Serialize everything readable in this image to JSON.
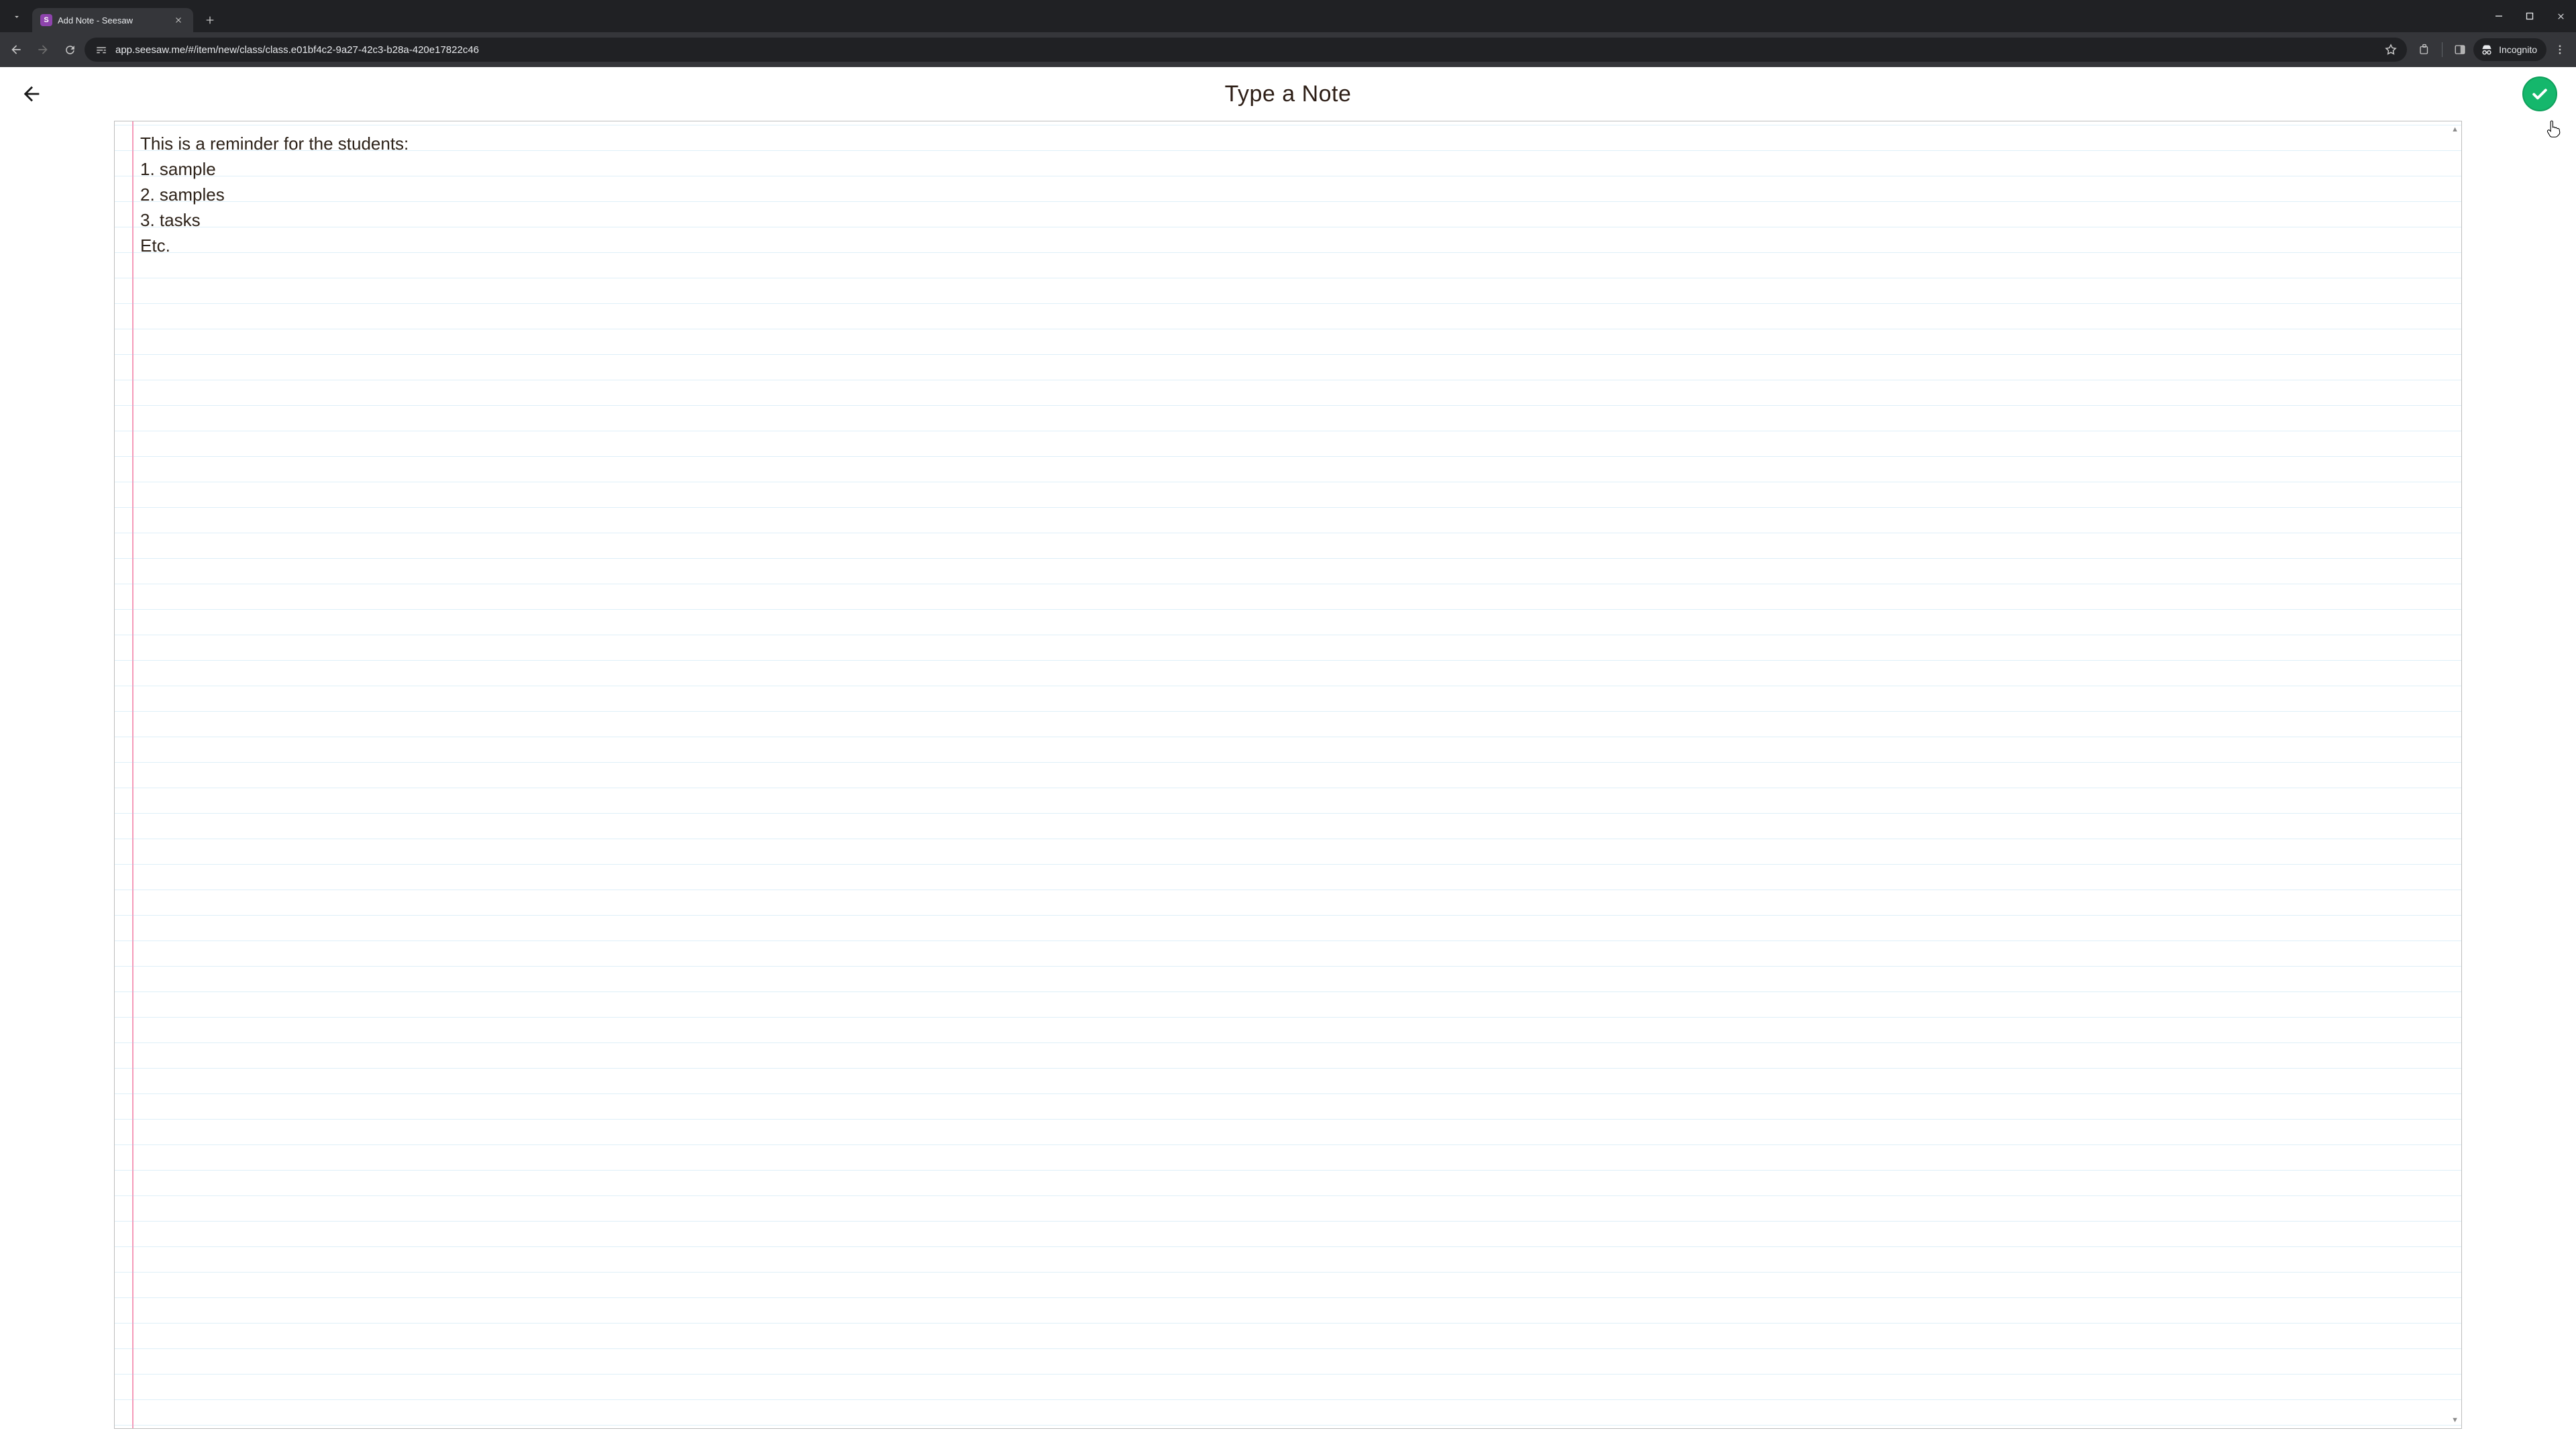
{
  "browser": {
    "tab_title": "Add Note - Seesaw",
    "favicon_letter": "S",
    "url": "app.seesaw.me/#/item/new/class/class.e01bf4c2-9a27-42c3-b28a-420e17822c46",
    "incognito_label": "Incognito"
  },
  "page": {
    "title": "Type a Note",
    "note_lines": [
      "This is a reminder for the students:",
      "1. sample",
      "2. samples",
      "3. tasks",
      "Etc."
    ]
  },
  "colors": {
    "confirm_green": "#15b76c"
  }
}
